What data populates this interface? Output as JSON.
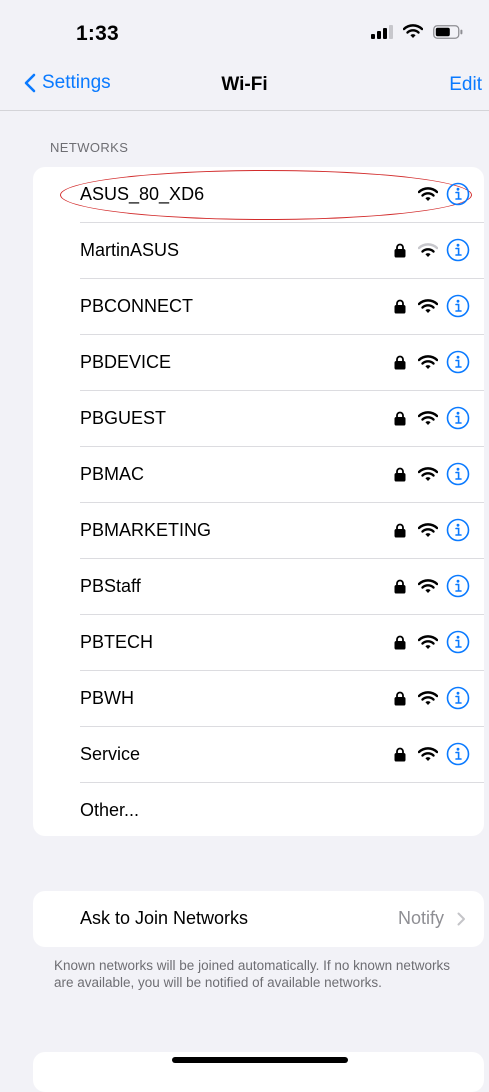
{
  "status_bar": {
    "time": "1:33",
    "icons": [
      "signal-icon",
      "wifi-icon",
      "battery-icon"
    ]
  },
  "nav": {
    "back_label": "Settings",
    "title": "Wi-Fi",
    "edit_label": "Edit"
  },
  "networks": {
    "header": "NETWORKS",
    "items": [
      {
        "name": "ASUS_80_XD6",
        "locked": false,
        "signal": "full"
      },
      {
        "name": "MartinASUS",
        "locked": true,
        "signal": "weak"
      },
      {
        "name": "PBCONNECT",
        "locked": true,
        "signal": "full"
      },
      {
        "name": "PBDEVICE",
        "locked": true,
        "signal": "full"
      },
      {
        "name": "PBGUEST",
        "locked": true,
        "signal": "full"
      },
      {
        "name": "PBMAC",
        "locked": true,
        "signal": "full"
      },
      {
        "name": "PBMARKETING",
        "locked": true,
        "signal": "full"
      },
      {
        "name": "PBStaff",
        "locked": true,
        "signal": "full"
      },
      {
        "name": "PBTECH",
        "locked": true,
        "signal": "full"
      },
      {
        "name": "PBWH",
        "locked": true,
        "signal": "full"
      },
      {
        "name": "Service",
        "locked": true,
        "signal": "full"
      }
    ],
    "other_label": "Other..."
  },
  "ask_to_join": {
    "label": "Ask to Join Networks",
    "value": "Notify",
    "footnote": "Known networks will be joined automatically. If no known networks are available, you will be notified of available networks."
  },
  "colors": {
    "accent": "#0a7aff",
    "highlight": "#d22b2b",
    "background": "#f2f2f7"
  }
}
